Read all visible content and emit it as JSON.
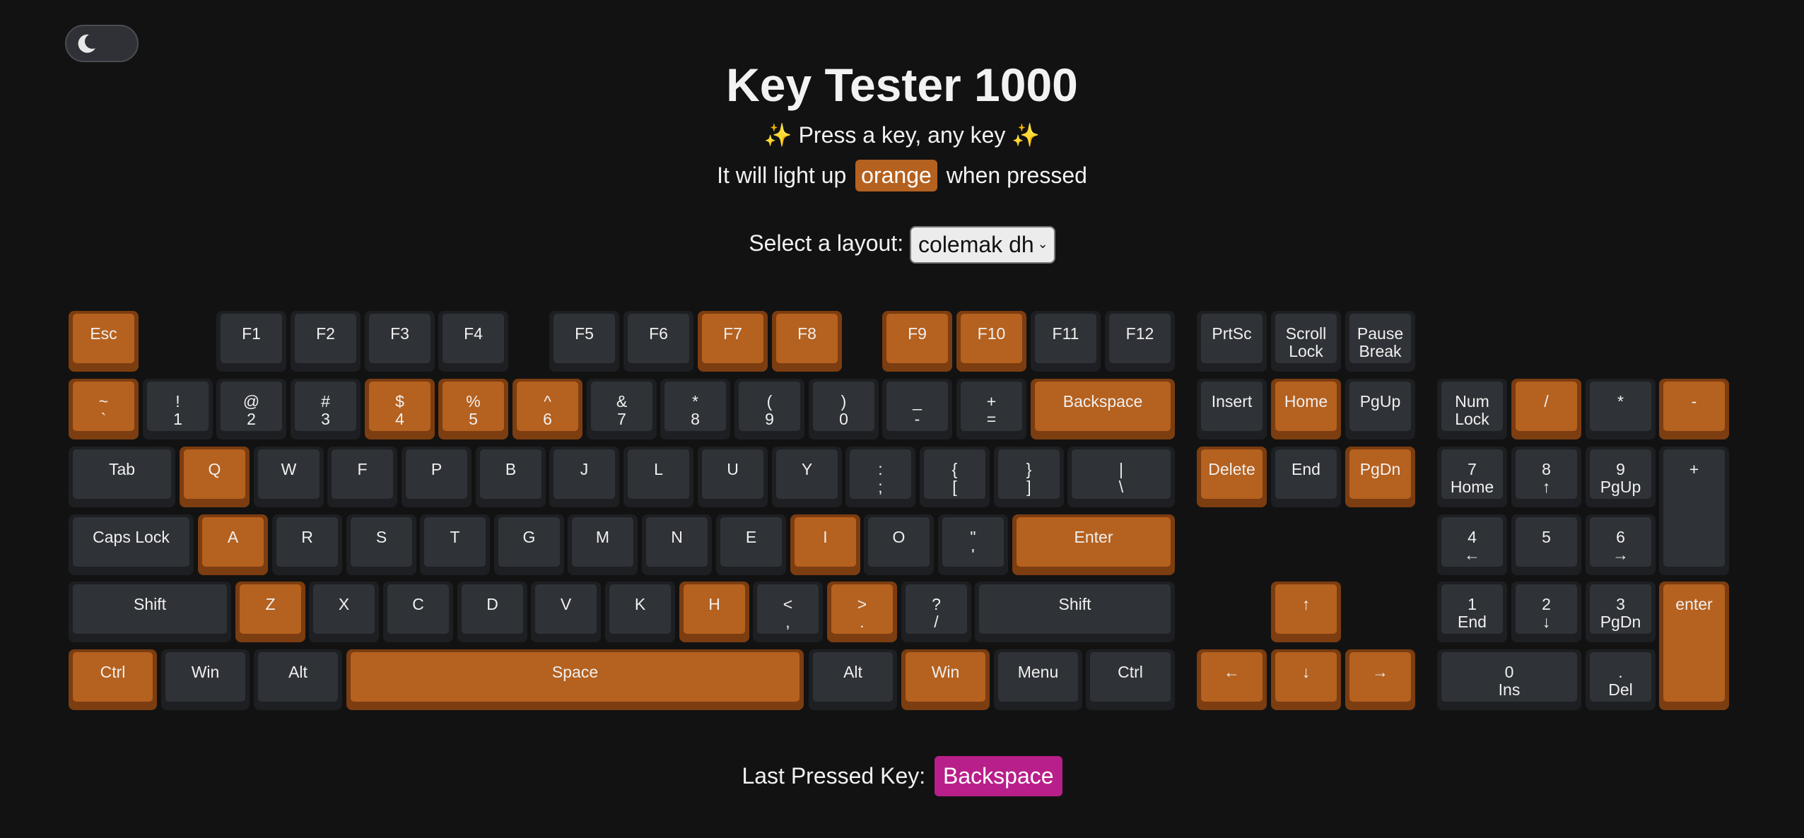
{
  "title": "Key Tester 1000",
  "subtitle": "✨ Press a key, any key ✨",
  "hint": {
    "before": "It will light up",
    "highlight": "orange",
    "after": "when pressed"
  },
  "layout_select": {
    "label": "Select a layout:",
    "value": "colemak dh"
  },
  "last_pressed": {
    "label": "Last Pressed Key:",
    "value": "Backspace"
  },
  "theme_toggle": {
    "icon": "moon-icon"
  },
  "colors": {
    "key": "#2f3236",
    "pressed": "#b5611f",
    "last_key": "#b81f8a",
    "background": "#121212"
  },
  "keys": {
    "esc": {
      "label": "Esc",
      "pressed": true
    },
    "f1": {
      "label": "F1",
      "pressed": false
    },
    "f2": {
      "label": "F2",
      "pressed": false
    },
    "f3": {
      "label": "F3",
      "pressed": false
    },
    "f4": {
      "label": "F4",
      "pressed": false
    },
    "f5": {
      "label": "F5",
      "pressed": false
    },
    "f6": {
      "label": "F6",
      "pressed": false
    },
    "f7": {
      "label": "F7",
      "pressed": true
    },
    "f8": {
      "label": "F8",
      "pressed": true
    },
    "f9": {
      "label": "F9",
      "pressed": true
    },
    "f10": {
      "label": "F10",
      "pressed": true
    },
    "f11": {
      "label": "F11",
      "pressed": false
    },
    "f12": {
      "label": "F12",
      "pressed": false
    },
    "prtsc": {
      "label": "PrtSc",
      "pressed": false
    },
    "scroll-lock": {
      "label": "Scroll",
      "label2": "Lock",
      "pressed": false
    },
    "pause-break": {
      "label": "Pause",
      "label2": "Break",
      "pressed": false
    },
    "backtick": {
      "label": "~",
      "label2": "`",
      "pressed": true
    },
    "digit-1": {
      "label": "!",
      "label2": "1",
      "pressed": false
    },
    "digit-2": {
      "label": "@",
      "label2": "2",
      "pressed": false
    },
    "digit-3": {
      "label": "#",
      "label2": "3",
      "pressed": false
    },
    "digit-4": {
      "label": "$",
      "label2": "4",
      "pressed": true
    },
    "digit-5": {
      "label": "%",
      "label2": "5",
      "pressed": true
    },
    "digit-6": {
      "label": "^",
      "label2": "6",
      "pressed": true
    },
    "digit-7": {
      "label": "&",
      "label2": "7",
      "pressed": false
    },
    "digit-8": {
      "label": "*",
      "label2": "8",
      "pressed": false
    },
    "digit-9": {
      "label": "(",
      "label2": "9",
      "pressed": false
    },
    "digit-0": {
      "label": ")",
      "label2": "0",
      "pressed": false
    },
    "minus": {
      "label": "_",
      "label2": "-",
      "pressed": false
    },
    "equal": {
      "label": "+",
      "label2": "=",
      "pressed": false
    },
    "backspace": {
      "label": "Backspace",
      "pressed": true
    },
    "insert": {
      "label": "Insert",
      "pressed": false
    },
    "home": {
      "label": "Home",
      "pressed": true
    },
    "pgup": {
      "label": "PgUp",
      "pressed": false
    },
    "numlock": {
      "label": "Num",
      "label2": "Lock",
      "pressed": false
    },
    "num-divide": {
      "label": "/",
      "pressed": true
    },
    "num-multiply": {
      "label": "*",
      "pressed": false
    },
    "num-minus": {
      "label": "-",
      "pressed": true
    },
    "tab": {
      "label": "Tab",
      "pressed": false
    },
    "q": {
      "label": "Q",
      "pressed": true
    },
    "w": {
      "label": "W",
      "pressed": false
    },
    "f": {
      "label": "F",
      "pressed": false
    },
    "p": {
      "label": "P",
      "pressed": false
    },
    "b": {
      "label": "B",
      "pressed": false
    },
    "j": {
      "label": "J",
      "pressed": false
    },
    "l": {
      "label": "L",
      "pressed": false
    },
    "u": {
      "label": "U",
      "pressed": false
    },
    "y": {
      "label": "Y",
      "pressed": false
    },
    "semicolon": {
      "label": ":",
      "label2": ";",
      "pressed": false
    },
    "bracket-left": {
      "label": "{",
      "label2": "[",
      "pressed": false
    },
    "bracket-right": {
      "label": "}",
      "label2": "]",
      "pressed": false
    },
    "backslash": {
      "label": "|",
      "label2": "\\",
      "pressed": false
    },
    "delete": {
      "label": "Delete",
      "pressed": true
    },
    "end": {
      "label": "End",
      "pressed": false
    },
    "pgdn": {
      "label": "PgDn",
      "pressed": true
    },
    "num-7": {
      "label": "7",
      "label2": "Home",
      "pressed": false
    },
    "num-8": {
      "label": "8",
      "label2": "↑",
      "pressed": false
    },
    "num-9": {
      "label": "9",
      "label2": "PgUp",
      "pressed": false
    },
    "num-plus": {
      "label": "+",
      "pressed": false
    },
    "caps-lock": {
      "label": "Caps Lock",
      "pressed": false
    },
    "a": {
      "label": "A",
      "pressed": true
    },
    "r": {
      "label": "R",
      "pressed": false
    },
    "s": {
      "label": "S",
      "pressed": false
    },
    "t": {
      "label": "T",
      "pressed": false
    },
    "g": {
      "label": "G",
      "pressed": false
    },
    "m": {
      "label": "M",
      "pressed": false
    },
    "n": {
      "label": "N",
      "pressed": false
    },
    "e": {
      "label": "E",
      "pressed": false
    },
    "i": {
      "label": "I",
      "pressed": true
    },
    "o": {
      "label": "O",
      "pressed": false
    },
    "quote": {
      "label": "\"",
      "label2": "'",
      "pressed": false
    },
    "enter": {
      "label": "Enter",
      "pressed": true
    },
    "num-4": {
      "label": "4",
      "label2": "←",
      "pressed": false
    },
    "num-5": {
      "label": "5",
      "pressed": false
    },
    "num-6": {
      "label": "6",
      "label2": "→",
      "pressed": false
    },
    "shift-left": {
      "label": "Shift",
      "pressed": false
    },
    "z": {
      "label": "Z",
      "pressed": true
    },
    "x": {
      "label": "X",
      "pressed": false
    },
    "c": {
      "label": "C",
      "pressed": false
    },
    "d": {
      "label": "D",
      "pressed": false
    },
    "v": {
      "label": "V",
      "pressed": false
    },
    "k": {
      "label": "K",
      "pressed": false
    },
    "h": {
      "label": "H",
      "pressed": true
    },
    "comma": {
      "label": "<",
      "label2": ",",
      "pressed": false
    },
    "period": {
      "label": ">",
      "label2": ".",
      "pressed": true
    },
    "slash": {
      "label": "?",
      "label2": "/",
      "pressed": false
    },
    "shift-right": {
      "label": "Shift",
      "pressed": false
    },
    "arrow-up": {
      "label": "↑",
      "pressed": true
    },
    "num-1": {
      "label": "1",
      "label2": "End",
      "pressed": false
    },
    "num-2": {
      "label": "2",
      "label2": "↓",
      "pressed": false
    },
    "num-3": {
      "label": "3",
      "label2": "PgDn",
      "pressed": false
    },
    "num-enter": {
      "label": "enter",
      "pressed": true
    },
    "ctrl-left": {
      "label": "Ctrl",
      "pressed": true
    },
    "win-left": {
      "label": "Win",
      "pressed": false
    },
    "alt-left": {
      "label": "Alt",
      "pressed": false
    },
    "space": {
      "label": "Space",
      "pressed": true
    },
    "alt-right": {
      "label": "Alt",
      "pressed": false
    },
    "win-right": {
      "label": "Win",
      "pressed": true
    },
    "menu": {
      "label": "Menu",
      "pressed": false
    },
    "ctrl-right": {
      "label": "Ctrl",
      "pressed": false
    },
    "arrow-left": {
      "label": "←",
      "pressed": true
    },
    "arrow-down": {
      "label": "↓",
      "pressed": true
    },
    "arrow-right": {
      "label": "→",
      "pressed": true
    },
    "num-0": {
      "label": "0",
      "label2": "Ins",
      "pressed": false
    },
    "num-decimal": {
      "label": ".",
      "label2": "Del",
      "pressed": false
    }
  }
}
